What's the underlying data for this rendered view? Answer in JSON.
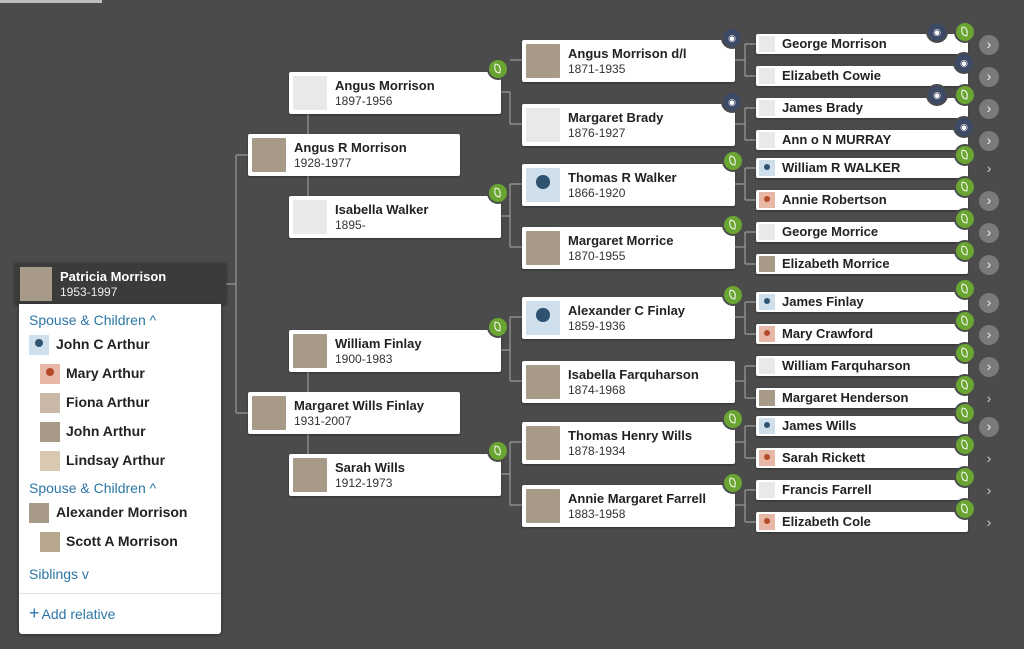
{
  "focus_person": {
    "name": "Patricia Morrison",
    "years": "1953-1997"
  },
  "panel": {
    "spouse_label_1": "Spouse & Children",
    "children_1": [
      "John C Arthur",
      "Mary Arthur",
      "Fiona Arthur",
      "John Arthur",
      "Lindsay Arthur"
    ],
    "spouse_label_2": "Spouse & Children",
    "children_2": [
      "Alexander Morrison",
      "Scott A Morrison"
    ],
    "siblings_label": "Siblings",
    "add_relative": "Add relative",
    "caret_up": "^",
    "caret_down": "v",
    "plus": "+"
  },
  "gen1": [
    {
      "name": "Angus R Morrison",
      "years": "1928-1977"
    },
    {
      "name": "Margaret Wills Finlay",
      "years": "1931-2007"
    }
  ],
  "gen2": [
    {
      "name": "Angus Morrison",
      "years": "1897-1956"
    },
    {
      "name": "Isabella Walker",
      "years": "1895-"
    },
    {
      "name": "William Finlay",
      "years": "1900-1983"
    },
    {
      "name": "Sarah Wills",
      "years": "1912-1973"
    }
  ],
  "gen3": [
    {
      "name": "Angus Morrison d/l",
      "years": "1871-1935"
    },
    {
      "name": "Margaret Brady",
      "years": "1876-1927"
    },
    {
      "name": "Thomas R Walker",
      "years": "1866-1920"
    },
    {
      "name": "Margaret Morrice",
      "years": "1870-1955"
    },
    {
      "name": "Alexander C Finlay",
      "years": "1859-1936"
    },
    {
      "name": "Isabella Farquharson",
      "years": "1874-1968"
    },
    {
      "name": "Thomas Henry Wills",
      "years": "1878-1934"
    },
    {
      "name": "Annie Margaret Farrell",
      "years": "1883-1958"
    }
  ],
  "gen4": [
    "George Morrison",
    "Elizabeth Cowie",
    "James Brady",
    "Ann o N MURRAY",
    "William R WALKER",
    "Annie Robertson",
    "George Morrice",
    "Elizabeth Morrice",
    "James Finlay",
    "Mary Crawford",
    "William Farquharson",
    "Margaret Henderson",
    "James Wills",
    "Sarah Rickett",
    "Francis Farrell",
    "Elizabeth Cole"
  ],
  "icons": {
    "hint": "leaf-hint-icon",
    "group": "people-group-icon",
    "expand": "chevron-right-icon"
  },
  "colors": {
    "background": "#4b4b4b",
    "hint_green": "#6aa532",
    "link_blue": "#2b76a6",
    "group_navy": "#3d4a66"
  }
}
